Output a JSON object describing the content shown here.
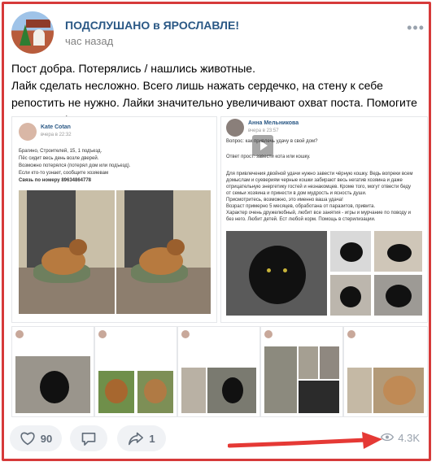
{
  "post": {
    "group_name": "ПОДСЛУШАНО в ЯРОСЛАВЛЕ!",
    "time": "час назад",
    "text_lines": [
      "Пост добра. Потерялись / нашлись животные.",
      "Лайк сделать несложно. Всего лишь нажать сердечко, на стену к себе репостить не нужно. Лайки значительно увеличивают охват поста. Помогите животным!"
    ]
  },
  "attachments": {
    "left_card": {
      "author": "Kate Cotan",
      "time": "вчера в 22:32",
      "lines": [
        "Брагино, Строителей, 15, 1 подъезд.",
        "Пёс сидит весь день возле дверей.",
        "Возможно потерялся (потерял дом или подъезд).",
        "Если кто-то узнает, сообщите хозяевам",
        "Связь по номеру 89634864778"
      ]
    },
    "right_card": {
      "author": "Анна Мельникова",
      "time": "вчера в 23:57",
      "lines": [
        "Вопрос: как привлечь удачу в свой дом?",
        "Ответ прост: завести кота или кошку.",
        "Для привлечения двойной удачи нужно завести чёрную кошку. Ведь вопреки всем",
        "домыслам и суевериям черные кошки забирают весь негатив хозяина и даже",
        "отрицательную энергетику гостей и незнакомцев. Кроме того, могут отвести беду",
        "от семьи хозяина и принести в дом мудрость и ясность души.",
        "Присмотритесь, возможно, это именно ваша удача!",
        "Возраст примерно 5 месяцев, обработана от паразитов, привита.",
        "Характер очень дружелюбный, любит все занятия - игры и мурчание по поводу и",
        "без него. Любит детей. Ест любой корм. Помощь в стерилизации."
      ]
    }
  },
  "actions": {
    "likes": "90",
    "shares": "1",
    "views": "4.3K"
  },
  "colors": {
    "accent": "#2a5885",
    "frame": "#d63a3a",
    "arrow": "#e53935",
    "button_bg": "#f0f2f5"
  },
  "icons": [
    "heart-icon",
    "comment-icon",
    "share-icon",
    "eye-icon",
    "more-icon",
    "play-icon"
  ]
}
